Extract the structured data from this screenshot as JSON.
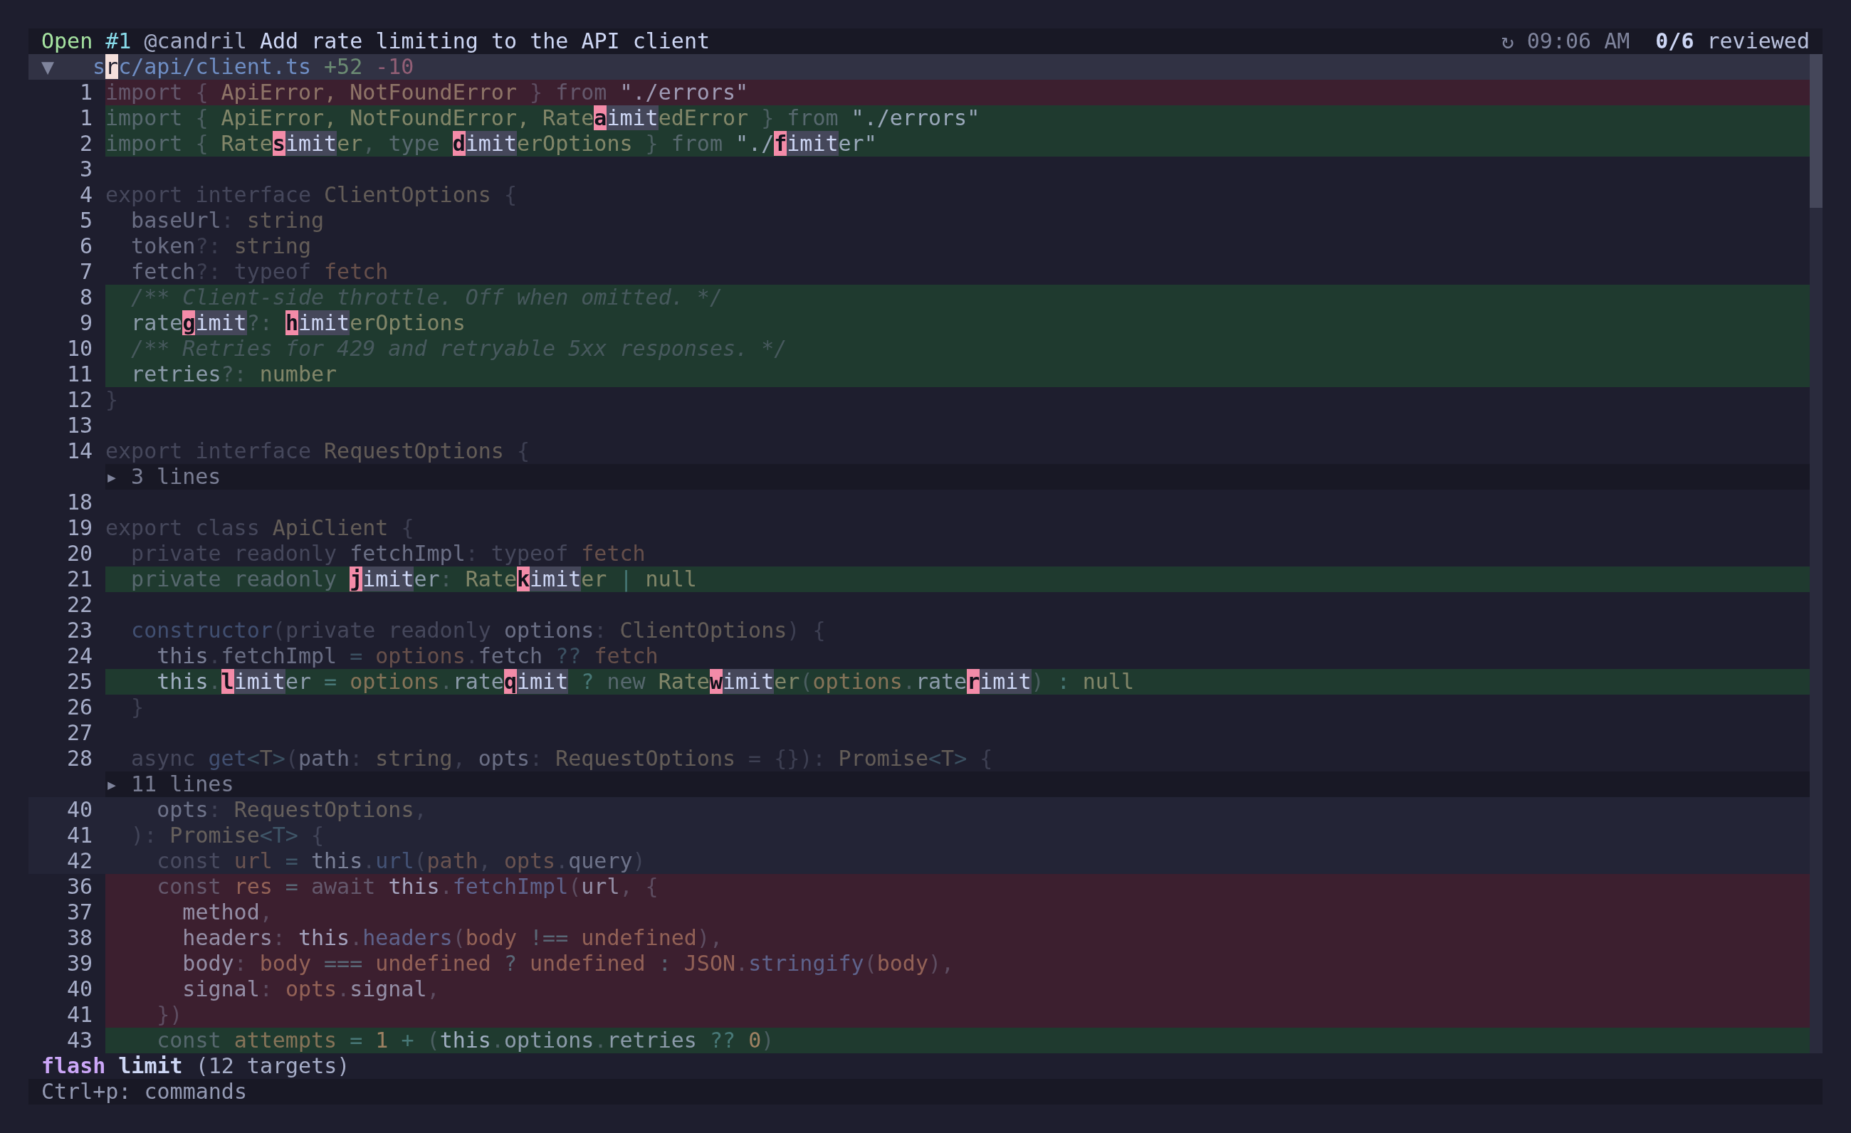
{
  "header": {
    "status": "Open",
    "number": "#1",
    "author": "@candril",
    "title": "Add rate limiting to the API client",
    "sync_glyph": "↻",
    "time": "09:06 AM",
    "reviewed_count": "0/6",
    "reviewed_label": "reviewed"
  },
  "file": {
    "toggle": "▼",
    "path": [
      {
        "text": "s",
        "cursor": false
      },
      {
        "text": "r",
        "cursor": true
      },
      {
        "text": "c/api/client.ts",
        "cursor": false
      }
    ],
    "additions": "+52",
    "deletions": "-10"
  },
  "lines": [
    {
      "kind": "removed",
      "number": "1",
      "segments": [
        {
          "text": "import",
          "kind": "keyword"
        },
        {
          "text": " { ",
          "kind": "punct"
        },
        {
          "text": "ApiError, NotFoundError",
          "kind": "type"
        },
        {
          "text": " } ",
          "kind": "punct"
        },
        {
          "text": "from ",
          "kind": "keyword"
        },
        {
          "text": "\"./errors\"",
          "kind": "string"
        }
      ]
    },
    {
      "kind": "added",
      "number": "1",
      "segments": [
        {
          "text": "import",
          "kind": "keyword"
        },
        {
          "text": " { ",
          "kind": "punct"
        },
        {
          "text": "ApiError, NotFoundError, Rate",
          "kind": "type"
        },
        {
          "text": "a",
          "kind": "label"
        },
        {
          "text": "imit",
          "kind": "match"
        },
        {
          "text": "edError",
          "kind": "type"
        },
        {
          "text": " } ",
          "kind": "punct"
        },
        {
          "text": "from ",
          "kind": "keyword"
        },
        {
          "text": "\"./errors\"",
          "kind": "string"
        }
      ]
    },
    {
      "kind": "added",
      "number": "2",
      "segments": [
        {
          "text": "import",
          "kind": "keyword"
        },
        {
          "text": " { ",
          "kind": "punct"
        },
        {
          "text": "Rate",
          "kind": "type"
        },
        {
          "text": "s",
          "kind": "label"
        },
        {
          "text": "imit",
          "kind": "match"
        },
        {
          "text": "er",
          "kind": "type"
        },
        {
          "text": ", ",
          "kind": "punct"
        },
        {
          "text": "type ",
          "kind": "keyword"
        },
        {
          "text": "d",
          "kind": "label"
        },
        {
          "text": "imit",
          "kind": "match"
        },
        {
          "text": "erOptions",
          "kind": "type"
        },
        {
          "text": " } ",
          "kind": "punct"
        },
        {
          "text": "from ",
          "kind": "keyword"
        },
        {
          "text": "\"./",
          "kind": "string"
        },
        {
          "text": "f",
          "kind": "label"
        },
        {
          "text": "imit",
          "kind": "match"
        },
        {
          "text": "er\"",
          "kind": "string"
        }
      ]
    },
    {
      "kind": "context",
      "number": "3"
    },
    {
      "kind": "context",
      "number": "4",
      "segments": [
        {
          "text": "export interface ",
          "kind": "keyword"
        },
        {
          "text": "ClientOptions",
          "kind": "type"
        },
        {
          "text": " {",
          "kind": "punct"
        }
      ]
    },
    {
      "kind": "context",
      "number": "5",
      "segments": [
        {
          "text": "  baseUrl",
          "kind": "ident"
        },
        {
          "text": ": ",
          "kind": "punct"
        },
        {
          "text": "string",
          "kind": "type"
        }
      ]
    },
    {
      "kind": "context",
      "number": "6",
      "segments": [
        {
          "text": "  token",
          "kind": "ident"
        },
        {
          "text": "?: ",
          "kind": "punct"
        },
        {
          "text": "string",
          "kind": "type"
        }
      ]
    },
    {
      "kind": "context",
      "number": "7",
      "segments": [
        {
          "text": "  fetch",
          "kind": "ident"
        },
        {
          "text": "?: ",
          "kind": "punct"
        },
        {
          "text": "typeof ",
          "kind": "keyword"
        },
        {
          "text": "fetch",
          "kind": "var"
        }
      ]
    },
    {
      "kind": "added",
      "number": "8",
      "segments": [
        {
          "text": "  /** Client-side throttle. Off when omitted. */",
          "kind": "comment"
        }
      ]
    },
    {
      "kind": "added",
      "number": "9",
      "segments": [
        {
          "text": "  rate",
          "kind": "ident"
        },
        {
          "text": "g",
          "kind": "label"
        },
        {
          "text": "imit",
          "kind": "match"
        },
        {
          "text": "?: ",
          "kind": "punct"
        },
        {
          "text": "h",
          "kind": "label"
        },
        {
          "text": "imit",
          "kind": "match"
        },
        {
          "text": "erOptions",
          "kind": "type"
        }
      ]
    },
    {
      "kind": "added",
      "number": "10",
      "segments": [
        {
          "text": "  /** Retries for 429 and retryable 5xx responses. */",
          "kind": "comment"
        }
      ]
    },
    {
      "kind": "added",
      "number": "11",
      "segments": [
        {
          "text": "  retries",
          "kind": "ident"
        },
        {
          "text": "?: ",
          "kind": "punct"
        },
        {
          "text": "number",
          "kind": "type"
        }
      ]
    },
    {
      "kind": "context",
      "number": "12",
      "segments": [
        {
          "text": "}",
          "kind": "punct"
        }
      ]
    },
    {
      "kind": "context",
      "number": "13"
    },
    {
      "kind": "context",
      "number": "14",
      "segments": [
        {
          "text": "export interface ",
          "kind": "keyword"
        },
        {
          "text": "RequestOptions",
          "kind": "type"
        },
        {
          "text": " {",
          "kind": "punct"
        }
      ]
    },
    {
      "kind": "fold",
      "glyph": "▸",
      "summary": "3 lines"
    },
    {
      "kind": "context",
      "number": "18"
    },
    {
      "kind": "context",
      "number": "19",
      "segments": [
        {
          "text": "export class ",
          "kind": "keyword"
        },
        {
          "text": "ApiClient",
          "kind": "type"
        },
        {
          "text": " {",
          "kind": "punct"
        }
      ]
    },
    {
      "kind": "context",
      "number": "20",
      "segments": [
        {
          "text": "  private readonly ",
          "kind": "keyword"
        },
        {
          "text": "fetchImpl",
          "kind": "ident"
        },
        {
          "text": ": ",
          "kind": "punct"
        },
        {
          "text": "typeof ",
          "kind": "keyword"
        },
        {
          "text": "fetch",
          "kind": "var"
        }
      ]
    },
    {
      "kind": "added",
      "number": "21",
      "segments": [
        {
          "text": "  private readonly ",
          "kind": "keyword"
        },
        {
          "text": "j",
          "kind": "label"
        },
        {
          "text": "imit",
          "kind": "match"
        },
        {
          "text": "er",
          "kind": "ident"
        },
        {
          "text": ": ",
          "kind": "punct"
        },
        {
          "text": "Rate",
          "kind": "type"
        },
        {
          "text": "k",
          "kind": "label"
        },
        {
          "text": "imit",
          "kind": "match"
        },
        {
          "text": "er",
          "kind": "type"
        },
        {
          "text": " | ",
          "kind": "op"
        },
        {
          "text": "null",
          "kind": "type"
        }
      ]
    },
    {
      "kind": "context",
      "number": "22"
    },
    {
      "kind": "context",
      "number": "23",
      "segments": [
        {
          "text": "  constructor",
          "kind": "func"
        },
        {
          "text": "(",
          "kind": "punct"
        },
        {
          "text": "private readonly ",
          "kind": "keyword"
        },
        {
          "text": "options",
          "kind": "ident"
        },
        {
          "text": ": ",
          "kind": "punct"
        },
        {
          "text": "ClientOptions",
          "kind": "type"
        },
        {
          "text": ") {",
          "kind": "punct"
        }
      ]
    },
    {
      "kind": "context",
      "number": "24",
      "segments": [
        {
          "text": "    this",
          "kind": "this"
        },
        {
          "text": ".",
          "kind": "punct"
        },
        {
          "text": "fetchImpl",
          "kind": "ident"
        },
        {
          "text": " = ",
          "kind": "op"
        },
        {
          "text": "options",
          "kind": "var"
        },
        {
          "text": ".",
          "kind": "punct"
        },
        {
          "text": "fetch",
          "kind": "ident"
        },
        {
          "text": " ?? ",
          "kind": "op"
        },
        {
          "text": "fetch",
          "kind": "var"
        }
      ]
    },
    {
      "kind": "added",
      "number": "25",
      "segments": [
        {
          "text": "    this",
          "kind": "this"
        },
        {
          "text": ".",
          "kind": "punct"
        },
        {
          "text": "l",
          "kind": "label"
        },
        {
          "text": "imit",
          "kind": "match"
        },
        {
          "text": "er",
          "kind": "ident"
        },
        {
          "text": " = ",
          "kind": "op"
        },
        {
          "text": "options",
          "kind": "var"
        },
        {
          "text": ".",
          "kind": "punct"
        },
        {
          "text": "rate",
          "kind": "ident"
        },
        {
          "text": "q",
          "kind": "label"
        },
        {
          "text": "imit",
          "kind": "match"
        },
        {
          "text": " ? ",
          "kind": "op"
        },
        {
          "text": "new ",
          "kind": "keyword"
        },
        {
          "text": "Rate",
          "kind": "type"
        },
        {
          "text": "w",
          "kind": "label"
        },
        {
          "text": "imit",
          "kind": "match"
        },
        {
          "text": "er",
          "kind": "type"
        },
        {
          "text": "(",
          "kind": "punct"
        },
        {
          "text": "options",
          "kind": "var"
        },
        {
          "text": ".",
          "kind": "punct"
        },
        {
          "text": "rate",
          "kind": "ident"
        },
        {
          "text": "r",
          "kind": "label"
        },
        {
          "text": "imit",
          "kind": "match"
        },
        {
          "text": ") ",
          "kind": "punct"
        },
        {
          "text": ": ",
          "kind": "op"
        },
        {
          "text": "null",
          "kind": "type"
        }
      ]
    },
    {
      "kind": "context",
      "number": "26",
      "segments": [
        {
          "text": "  }",
          "kind": "punct"
        }
      ]
    },
    {
      "kind": "context",
      "number": "27"
    },
    {
      "kind": "context",
      "number": "28",
      "segments": [
        {
          "text": "  async ",
          "kind": "keyword"
        },
        {
          "text": "get",
          "kind": "func"
        },
        {
          "text": "<",
          "kind": "op"
        },
        {
          "text": "T",
          "kind": "type"
        },
        {
          "text": ">",
          "kind": "op"
        },
        {
          "text": "(",
          "kind": "punct"
        },
        {
          "text": "path",
          "kind": "ident"
        },
        {
          "text": ": ",
          "kind": "punct"
        },
        {
          "text": "string",
          "kind": "type"
        },
        {
          "text": ", ",
          "kind": "punct"
        },
        {
          "text": "opts",
          "kind": "ident"
        },
        {
          "text": ": ",
          "kind": "punct"
        },
        {
          "text": "RequestOptions",
          "kind": "type"
        },
        {
          "text": " = {}): ",
          "kind": "punct"
        },
        {
          "text": "Promise",
          "kind": "type"
        },
        {
          "text": "<",
          "kind": "op"
        },
        {
          "text": "T",
          "kind": "type"
        },
        {
          "text": ">",
          "kind": "op"
        },
        {
          "text": " {",
          "kind": "punct"
        }
      ]
    },
    {
      "kind": "fold",
      "glyph": "▸",
      "summary": "11 lines"
    },
    {
      "kind": "expanded",
      "number": "40",
      "segments": [
        {
          "text": "    opts",
          "kind": "ident"
        },
        {
          "text": ": ",
          "kind": "punct"
        },
        {
          "text": "RequestOptions",
          "kind": "type"
        },
        {
          "text": ",",
          "kind": "punct"
        }
      ]
    },
    {
      "kind": "expanded",
      "number": "41",
      "segments": [
        {
          "text": "  ): ",
          "kind": "punct"
        },
        {
          "text": "Promise",
          "kind": "type"
        },
        {
          "text": "<T>",
          "kind": "op"
        },
        {
          "text": " {",
          "kind": "punct"
        }
      ]
    },
    {
      "kind": "expanded",
      "number": "42",
      "segments": [
        {
          "text": "    const ",
          "kind": "keyword"
        },
        {
          "text": "url",
          "kind": "var"
        },
        {
          "text": " = ",
          "kind": "op"
        },
        {
          "text": "this",
          "kind": "this"
        },
        {
          "text": ".",
          "kind": "punct"
        },
        {
          "text": "url",
          "kind": "func"
        },
        {
          "text": "(",
          "kind": "punct"
        },
        {
          "text": "path",
          "kind": "var"
        },
        {
          "text": ", ",
          "kind": "punct"
        },
        {
          "text": "opts",
          "kind": "var"
        },
        {
          "text": ".",
          "kind": "punct"
        },
        {
          "text": "query",
          "kind": "ident"
        },
        {
          "text": ")",
          "kind": "punct"
        }
      ]
    },
    {
      "kind": "removed",
      "number": "36",
      "segments": [
        {
          "text": "    const ",
          "kind": "keyword"
        },
        {
          "text": "res",
          "kind": "var"
        },
        {
          "text": " = ",
          "kind": "op"
        },
        {
          "text": "await ",
          "kind": "keyword"
        },
        {
          "text": "this",
          "kind": "this"
        },
        {
          "text": ".",
          "kind": "punct"
        },
        {
          "text": "fetchImpl",
          "kind": "func"
        },
        {
          "text": "(",
          "kind": "punct"
        },
        {
          "text": "url",
          "kind": "ident"
        },
        {
          "text": ", {",
          "kind": "punct"
        }
      ]
    },
    {
      "kind": "removed",
      "number": "37",
      "segments": [
        {
          "text": "      method",
          "kind": "ident"
        },
        {
          "text": ",",
          "kind": "punct"
        }
      ]
    },
    {
      "kind": "removed",
      "number": "38",
      "segments": [
        {
          "text": "      headers",
          "kind": "ident"
        },
        {
          "text": ": ",
          "kind": "punct"
        },
        {
          "text": "this",
          "kind": "this"
        },
        {
          "text": ".",
          "kind": "punct"
        },
        {
          "text": "headers",
          "kind": "func"
        },
        {
          "text": "(",
          "kind": "punct"
        },
        {
          "text": "body",
          "kind": "var"
        },
        {
          "text": " !== ",
          "kind": "op"
        },
        {
          "text": "undefined",
          "kind": "var"
        },
        {
          "text": "),",
          "kind": "punct"
        }
      ]
    },
    {
      "kind": "removed",
      "number": "39",
      "segments": [
        {
          "text": "      body",
          "kind": "ident"
        },
        {
          "text": ": ",
          "kind": "punct"
        },
        {
          "text": "body",
          "kind": "var"
        },
        {
          "text": " === ",
          "kind": "op"
        },
        {
          "text": "undefined",
          "kind": "var"
        },
        {
          "text": " ? ",
          "kind": "op"
        },
        {
          "text": "undefined",
          "kind": "var"
        },
        {
          "text": " : ",
          "kind": "op"
        },
        {
          "text": "JSON",
          "kind": "var"
        },
        {
          "text": ".",
          "kind": "punct"
        },
        {
          "text": "stringify",
          "kind": "func"
        },
        {
          "text": "(",
          "kind": "punct"
        },
        {
          "text": "body",
          "kind": "var"
        },
        {
          "text": "),",
          "kind": "punct"
        }
      ]
    },
    {
      "kind": "removed",
      "number": "40",
      "segments": [
        {
          "text": "      signal",
          "kind": "ident"
        },
        {
          "text": ": ",
          "kind": "punct"
        },
        {
          "text": "opts",
          "kind": "var"
        },
        {
          "text": ".",
          "kind": "punct"
        },
        {
          "text": "signal",
          "kind": "ident"
        },
        {
          "text": ",",
          "kind": "punct"
        }
      ]
    },
    {
      "kind": "removed",
      "number": "41",
      "segments": [
        {
          "text": "    })",
          "kind": "punct"
        }
      ]
    },
    {
      "kind": "added",
      "number": "43",
      "segments": [
        {
          "text": "    const ",
          "kind": "keyword"
        },
        {
          "text": "attempts",
          "kind": "var"
        },
        {
          "text": " = ",
          "kind": "op"
        },
        {
          "text": "1",
          "kind": "number"
        },
        {
          "text": " + ",
          "kind": "op"
        },
        {
          "text": "(",
          "kind": "punct"
        },
        {
          "text": "this",
          "kind": "this"
        },
        {
          "text": ".",
          "kind": "punct"
        },
        {
          "text": "options",
          "kind": "ident"
        },
        {
          "text": ".",
          "kind": "punct"
        },
        {
          "text": "retries",
          "kind": "ident"
        },
        {
          "text": " ?? ",
          "kind": "op"
        },
        {
          "text": "0",
          "kind": "number"
        },
        {
          "text": ")",
          "kind": "punct"
        }
      ]
    }
  ],
  "footer": {
    "mode": "flash",
    "query": "limit",
    "targets": "(12 targets)"
  },
  "status_bar": {
    "hint": "Ctrl+p: commands"
  }
}
